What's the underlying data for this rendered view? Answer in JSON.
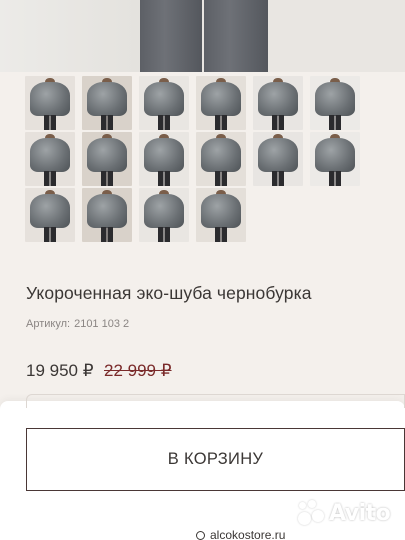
{
  "product": {
    "title": "Укороченная эко-шуба чернобурка",
    "article_label": "Артикул:",
    "article_value": "2101 103 2",
    "price": "19 950 ₽",
    "old_price": "22 999 ₽"
  },
  "gallery": {
    "thumbnail_count": 16,
    "thumbnails": [
      {
        "alt": "photo-1"
      },
      {
        "alt": "photo-2"
      },
      {
        "alt": "photo-3"
      },
      {
        "alt": "photo-4"
      },
      {
        "alt": "photo-5"
      },
      {
        "alt": "photo-6"
      },
      {
        "alt": "photo-7"
      },
      {
        "alt": "photo-8"
      },
      {
        "alt": "photo-9"
      },
      {
        "alt": "photo-10"
      },
      {
        "alt": "photo-11"
      },
      {
        "alt": "photo-12"
      },
      {
        "alt": "photo-13"
      },
      {
        "alt": "photo-14"
      },
      {
        "alt": "photo-15"
      },
      {
        "alt": "photo-16"
      }
    ]
  },
  "cart": {
    "button_label": "В КОРЗИНУ"
  },
  "browser": {
    "url_partial": "alcokostore.ru"
  },
  "watermark": {
    "text": "Avito"
  },
  "colors": {
    "background": "#f4f0ec",
    "old_price": "#7a2a2a",
    "button_border": "#4a3736"
  }
}
